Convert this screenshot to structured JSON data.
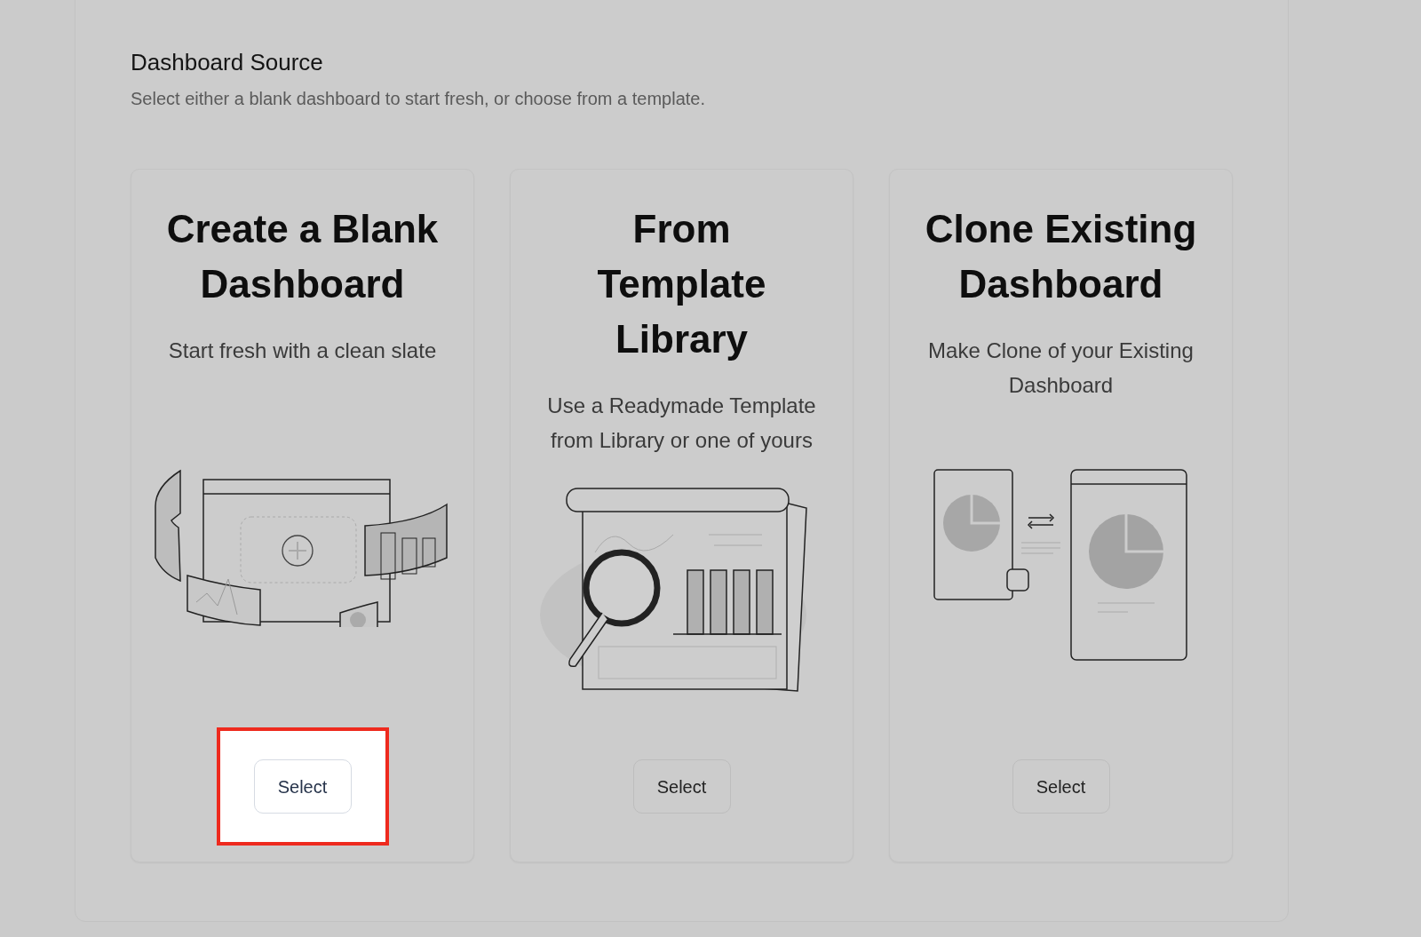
{
  "section": {
    "title": "Dashboard Source",
    "description": "Select either a blank dashboard to start fresh, or choose from a template."
  },
  "options": [
    {
      "kind": "blank",
      "title": "Create a Blank\nDashboard",
      "description": "Start fresh with a clean slate",
      "button": "Select",
      "highlighted": true
    },
    {
      "kind": "template",
      "title": "From\nTemplate\nLibrary",
      "description": "Use a Readymade Template from Library or one of yours",
      "button": "Select",
      "highlighted": false
    },
    {
      "kind": "clone",
      "title": "Clone Existing\nDashboard",
      "description": "Make Clone of your Existing Dashboard",
      "button": "Select",
      "highlighted": false
    }
  ]
}
